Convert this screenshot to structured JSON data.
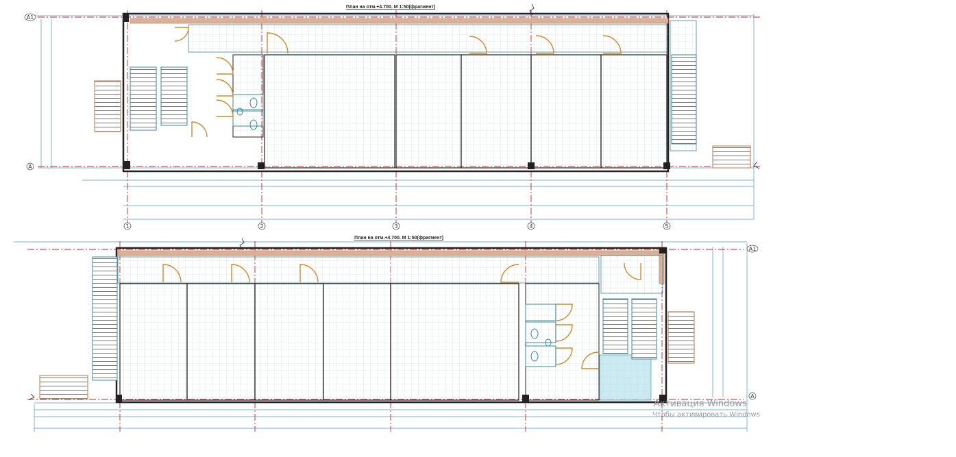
{
  "plans": [
    {
      "title": "План на отм.+4.700. М 1:50(фрагмент)"
    },
    {
      "title": "План на отм.+4.700. М 1:50(фрагмент)"
    }
  ],
  "axes_top": [
    "1",
    "2",
    "3",
    "4",
    "5"
  ],
  "axes_rows_top": [
    "А1",
    "А"
  ],
  "axes_rows_bottom": [
    "А1",
    "А"
  ],
  "watermark": {
    "title": "Активация Windows",
    "subtitle": "Чтобы активировать Windows"
  },
  "colors": {
    "wall": "#222222",
    "partition": "#3a8a9a",
    "grid_axis": "#cc2222",
    "tile_grid": "#c9d6dc",
    "door": "#d08a2a",
    "slab_edge": "#c98b6a",
    "dimension": "#4a9ac9",
    "glazing": "#bfe7ef"
  }
}
